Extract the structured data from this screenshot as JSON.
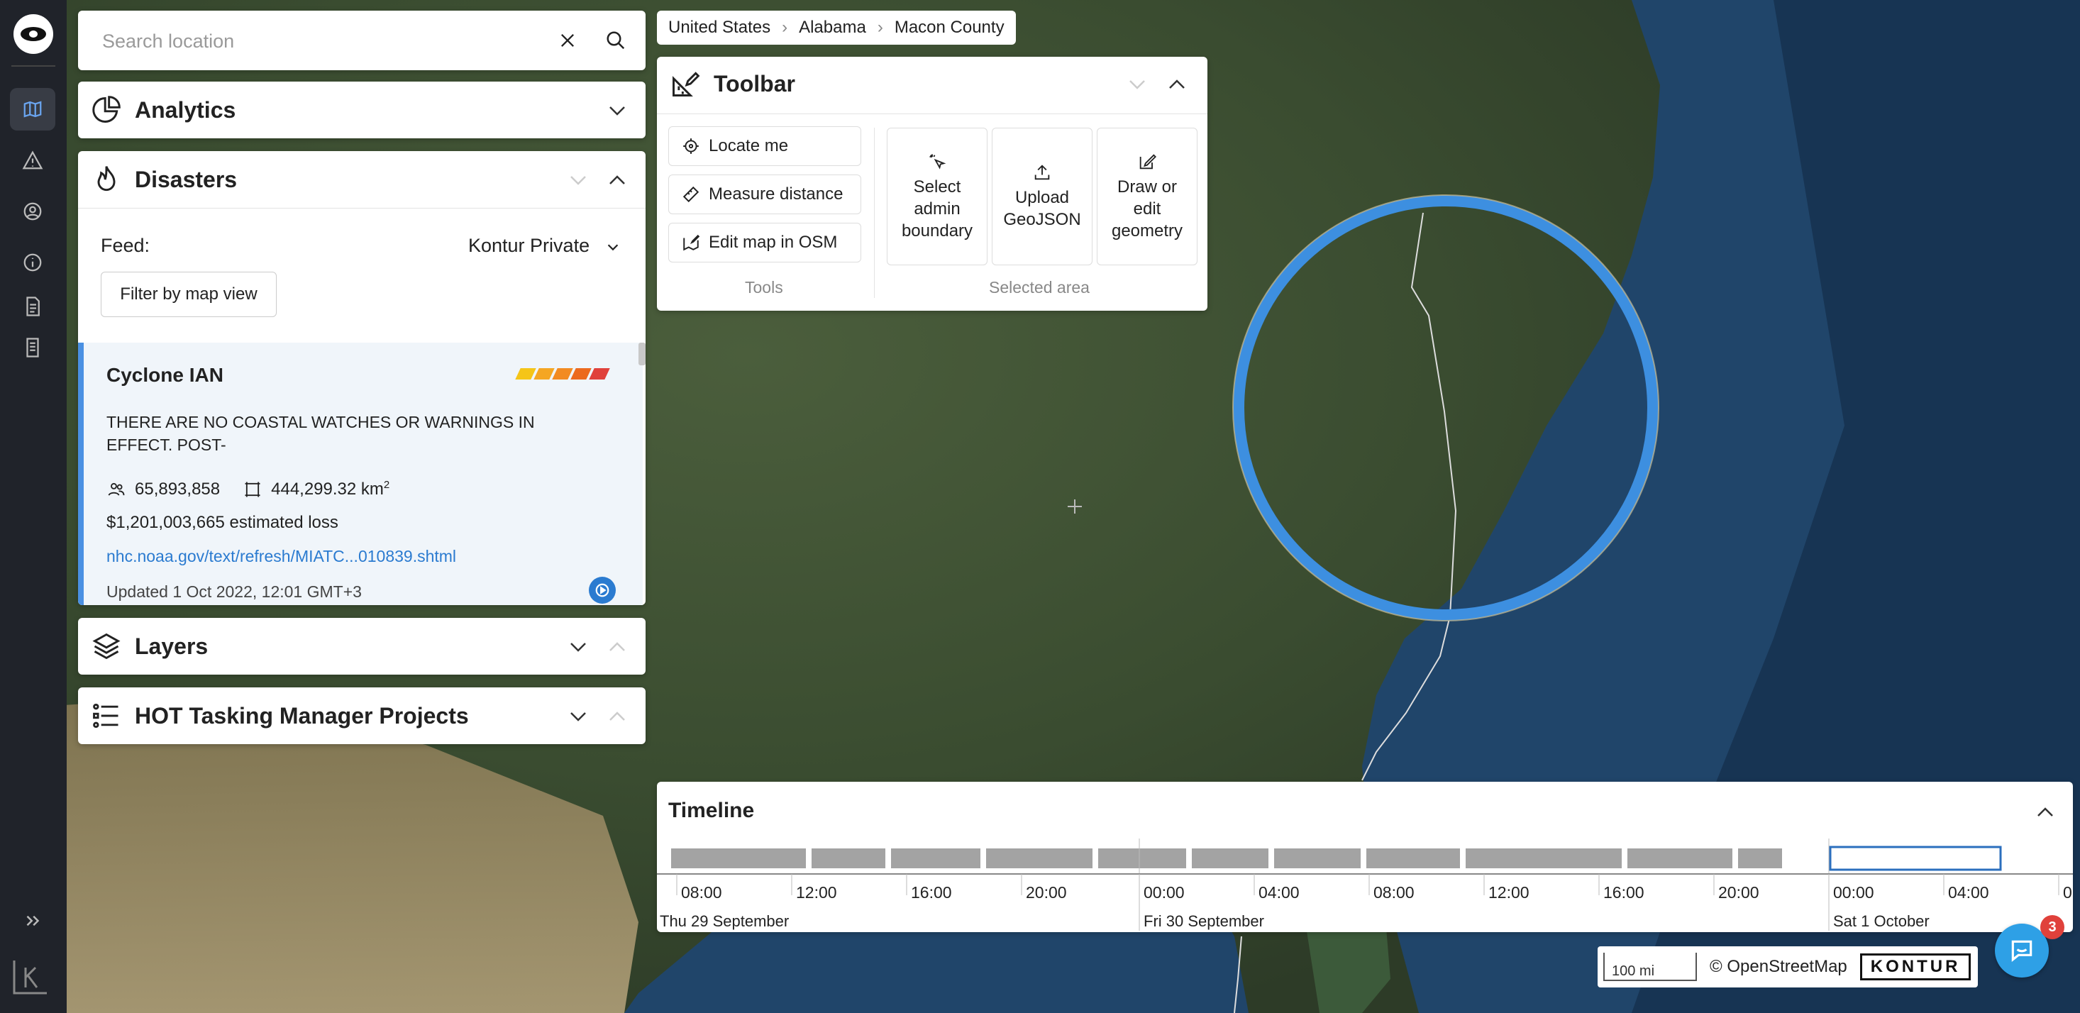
{
  "search": {
    "placeholder": "Search location"
  },
  "sidebar": {
    "items": [
      {
        "name": "map",
        "icon": "map-icon",
        "active": true
      },
      {
        "name": "disasters",
        "icon": "warning-icon",
        "active": false
      },
      {
        "name": "profile",
        "icon": "user-circle-icon",
        "active": false
      },
      {
        "name": "about",
        "icon": "info-icon",
        "active": false
      },
      {
        "name": "reports",
        "icon": "document-icon",
        "active": false
      },
      {
        "name": "notes",
        "icon": "document-lines-icon",
        "active": false
      }
    ],
    "expand_icon": "double-chevron-right-icon"
  },
  "analytics": {
    "title": "Analytics"
  },
  "disasters": {
    "title": "Disasters",
    "feed_label": "Feed:",
    "feed_value": "Kontur Private",
    "filter_button": "Filter by map view",
    "card": {
      "title": "Cyclone IAN",
      "description": "THERE ARE NO COASTAL WATCHES OR WARNINGS IN EFFECT. POST-",
      "population": "65,893,858",
      "area": "444,299.32 km",
      "area_sup": "2",
      "loss": "$1,201,003,665 estimated loss",
      "link": "nhc.noaa.gov/text/refresh/MIATC...010839.shtml",
      "updated": "Updated 1 Oct 2022, 12:01 GMT+3",
      "severity_colors": [
        "#f5c518",
        "#f5a623",
        "#f28b22",
        "#ec6a1e",
        "#e0413b"
      ]
    }
  },
  "layers": {
    "title": "Layers"
  },
  "hot": {
    "title": "HOT Tasking Manager Projects"
  },
  "breadcrumbs": [
    "United States",
    "Alabama",
    "Macon County"
  ],
  "toolbar": {
    "title": "Toolbar",
    "tools": [
      "Locate me",
      "Measure distance",
      "Edit map in OSM"
    ],
    "tools_label": "Tools",
    "selected_area": [
      "Select admin boundary",
      "Upload GeoJSON",
      "Draw or edit geometry"
    ],
    "selected_area_label": "Selected area"
  },
  "timeline": {
    "title": "Timeline",
    "ticks": [
      "08:00",
      "12:00",
      "16:00",
      "20:00",
      "00:00",
      "04:00",
      "08:00",
      "12:00",
      "16:00",
      "20:00",
      "00:00",
      "04:00",
      "0"
    ],
    "days": [
      "Thu 29 September",
      "Fri 30 September",
      "Sat 1 October"
    ]
  },
  "map": {
    "scale": "100 mi",
    "attribution": "© OpenStreetMap",
    "brand": "KONTUR",
    "ring_color": "#3d8fe0"
  },
  "chat": {
    "badge": "3"
  }
}
